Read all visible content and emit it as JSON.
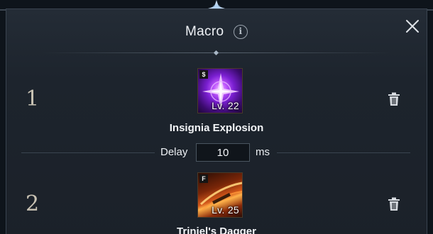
{
  "dialog": {
    "title": "Macro",
    "info_icon": "info-icon",
    "close_icon": "close-icon"
  },
  "macros": [
    {
      "index": "1",
      "skill_name": "Insignia Explosion",
      "level": "Lv. 22",
      "badge": "$",
      "icon": "purple-compass-burst-icon",
      "accent": "#b34dff",
      "delete_icon": "trash-icon"
    },
    {
      "index": "2",
      "skill_name": "Triniel's Dagger",
      "level": "Lv. 25",
      "badge": "F",
      "icon": "orange-dagger-slash-icon",
      "accent": "#ff8a2a",
      "delete_icon": "trash-icon"
    }
  ],
  "delay": {
    "label": "Delay",
    "value": "10",
    "unit": "ms"
  }
}
